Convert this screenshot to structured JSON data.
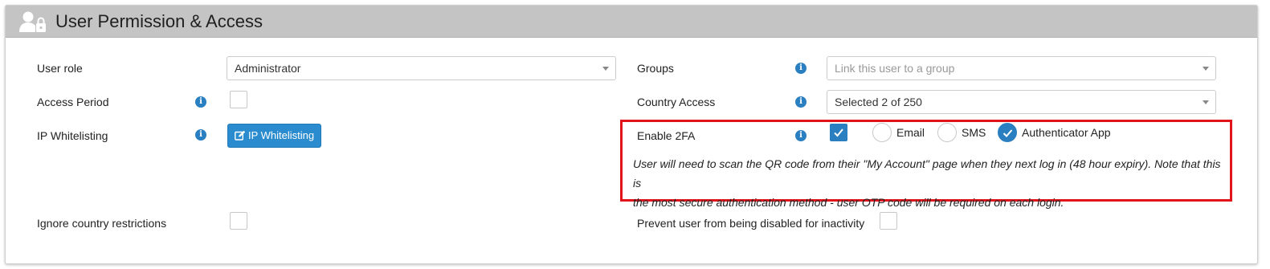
{
  "header": {
    "title": "User Permission & Access",
    "icon": "user-lock-icon"
  },
  "left": {
    "user_role": {
      "label": "User role",
      "value": "Administrator"
    },
    "access_period": {
      "label": "Access Period",
      "checked": false
    },
    "ip_whitelisting": {
      "label": "IP Whitelisting",
      "button_label": "IP Whitelisting",
      "button_icon": "edit-icon"
    },
    "ignore_country": {
      "label": "Ignore country restrictions",
      "checked": false
    }
  },
  "right": {
    "groups": {
      "label": "Groups",
      "placeholder": "Link this user to a group"
    },
    "country_access": {
      "label": "Country Access",
      "value": "Selected 2 of 250"
    },
    "enable_2fa": {
      "label": "Enable 2FA",
      "checked": true,
      "options": [
        {
          "label": "Email",
          "selected": false
        },
        {
          "label": "SMS",
          "selected": false
        },
        {
          "label": "Authenticator App",
          "selected": true
        }
      ],
      "note_line1": "User will need to scan the QR code from their \"My Account\" page when they next log in (48 hour expiry). Note that this is",
      "note_line2": "the most secure authentication method - user OTP code will be required on each login."
    },
    "prevent_disable": {
      "label": "Prevent user from being disabled for inactivity",
      "checked": false
    }
  },
  "colors": {
    "accent": "#2a7fc1",
    "highlight": "#e0151b",
    "header_bg": "#c4c4c4"
  }
}
